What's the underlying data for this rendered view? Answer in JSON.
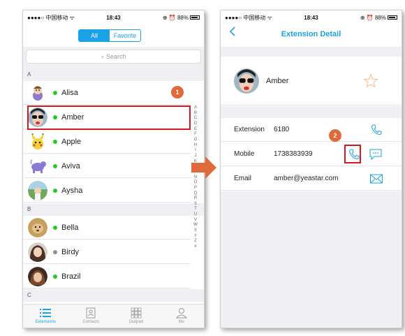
{
  "status": {
    "carrier": "●●●●○ 中国移动 ᯤ",
    "time": "18:43",
    "right": "⊕ ⏰ 88%"
  },
  "left": {
    "segments": [
      {
        "label": "All",
        "active": true
      },
      {
        "label": "Favorite",
        "active": false
      }
    ],
    "search_placeholder": "Search",
    "sections": [
      {
        "letter": "A",
        "contacts": [
          {
            "name": "Alisa",
            "status": "online",
            "status_color": "#22cc22"
          },
          {
            "name": "Amber",
            "status": "online",
            "status_color": "#22cc22"
          },
          {
            "name": "Apple",
            "status": "online",
            "status_color": "#22cc22"
          },
          {
            "name": "Aviva",
            "status": "online",
            "status_color": "#22cc22"
          },
          {
            "name": "Aysha",
            "status": "online",
            "status_color": "#22cc22"
          }
        ]
      },
      {
        "letter": "B",
        "contacts": [
          {
            "name": "Bella",
            "status": "online",
            "status_color": "#22cc22"
          },
          {
            "name": "Birdy",
            "status": "offline",
            "status_color": "#8e8e8e"
          },
          {
            "name": "Brazil",
            "status": "online",
            "status_color": "#22cc22"
          }
        ]
      },
      {
        "letter": "C",
        "contacts": []
      }
    ],
    "index_letters": "A B C D E F G H I J K L M N O P Q R S T U V W X Y Z #",
    "tabs": [
      {
        "label": "Extensions",
        "icon": "list-icon",
        "active": true
      },
      {
        "label": "Contacts",
        "icon": "contacts-book-icon",
        "active": false
      },
      {
        "label": "Dialpad",
        "icon": "dialpad-icon",
        "active": false
      },
      {
        "label": "Me",
        "icon": "person-icon",
        "active": false
      }
    ]
  },
  "right": {
    "back_icon": "chevron-left-icon",
    "title": "Extension Detail",
    "contact_name": "Amber",
    "favorite_icon": "star-outline-icon",
    "details": [
      {
        "label": "Extension",
        "value": "6180",
        "actions": [
          "phone-icon"
        ]
      },
      {
        "label": "Mobile",
        "value": "1738383939",
        "actions": [
          "phone-icon",
          "message-icon"
        ]
      },
      {
        "label": "Email",
        "value": "amber@yeastar.com",
        "actions": [
          "mail-icon"
        ]
      }
    ]
  },
  "callouts": [
    "1",
    "2"
  ],
  "colors": {
    "accent": "#1aa2e8",
    "highlight": "#d8171f",
    "callout": "#e06a3a",
    "arrow": "#e06a3a",
    "star": "#f6b37f"
  }
}
